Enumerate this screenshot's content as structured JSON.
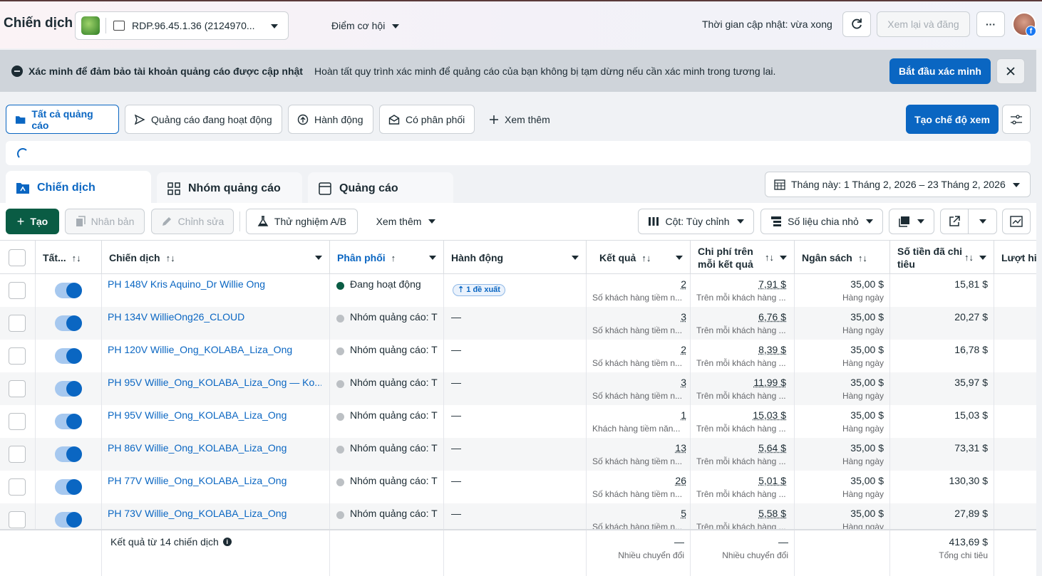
{
  "header": {
    "title": "Chiến dịch",
    "account_name": "RDP.96.45.1.36 (2124970...",
    "opportunity": "Điểm cơ hội",
    "update_time": "Thời gian cập nhật: vừa xong",
    "review_publish": "Xem lại và đăng",
    "more": "···"
  },
  "banner": {
    "bold": "Xác minh để đảm bảo tài khoản quảng cáo được cập nhật",
    "text": "Hoàn tất quy trình xác minh để quảng cáo của bạn không bị tạm dừng nếu cần xác minh trong tương lai.",
    "action": "Bắt đầu xác minh"
  },
  "filter_tabs": {
    "all": "Tất cả quảng cáo",
    "active": "Quảng cáo đang hoạt động",
    "actions": "Hành động",
    "delivered": "Có phân phối",
    "more": "Xem thêm",
    "create_view": "Tạo chế độ xem"
  },
  "level_tabs": {
    "campaign": "Chiến dịch",
    "adset": "Nhóm quảng cáo",
    "ad": "Quảng cáo"
  },
  "date_range": "Tháng này: 1 Tháng 2, 2026 – 23 Tháng 2, 2026",
  "toolbar": {
    "create": "Tạo",
    "duplicate": "Nhân bản",
    "edit": "Chỉnh sửa",
    "ab_test": "Thử nghiệm A/B",
    "more": "Xem thêm",
    "columns": "Cột: Tùy chỉnh",
    "breakdown": "Số liệu chia nhỏ"
  },
  "columns": {
    "toggle": "Tất...",
    "campaign": "Chiến dịch",
    "delivery": "Phân phối",
    "actions": "Hành động",
    "results": "Kết quả",
    "cpr_line1": "Chi phí trên",
    "cpr_line2": "mỗi kết quả",
    "budget": "Ngân sách",
    "spent_line1": "Số tiền đã chi",
    "spent_line2": "tiêu",
    "reach": "Lượt hi"
  },
  "rows": [
    {
      "name": "PH 148V Kris Aquino_Dr Willie Ong",
      "status": "active",
      "delivery": "Đang hoạt động",
      "action": "1 đề xuất",
      "result": "2",
      "result_sub": "Số khách hàng tiềm n...",
      "cpr": "7,91 $",
      "cpr_sub": "Trên mỗi khách hàng ...",
      "budget": "35,00 $",
      "budget_sub": "Hàng ngày",
      "spent": "15,81 $"
    },
    {
      "name": "PH 134V WillieOng26_CLOUD",
      "status": "off",
      "delivery": "Nhóm quảng cáo: T",
      "action": "—",
      "result": "3",
      "result_sub": "Số khách hàng tiềm n...",
      "cpr": "6,76 $",
      "cpr_sub": "Trên mỗi khách hàng ...",
      "budget": "35,00 $",
      "budget_sub": "Hàng ngày",
      "spent": "20,27 $"
    },
    {
      "name": "PH 120V Willie_Ong_KOLABA_Liza_Ong",
      "status": "off",
      "delivery": "Nhóm quảng cáo: T",
      "action": "—",
      "result": "2",
      "result_sub": "Số khách hàng tiềm n...",
      "cpr": "8,39 $",
      "cpr_sub": "Trên mỗi khách hàng ...",
      "budget": "35,00 $",
      "budget_sub": "Hàng ngày",
      "spent": "16,78 $"
    },
    {
      "name": "PH 95V Willie_Ong_KOLABA_Liza_Ong — Ko...",
      "status": "off",
      "delivery": "Nhóm quảng cáo: T",
      "action": "—",
      "result": "3",
      "result_sub": "Số khách hàng tiềm n...",
      "cpr": "11,99 $",
      "cpr_sub": "Trên mỗi khách hàng ...",
      "budget": "35,00 $",
      "budget_sub": "Hàng ngày",
      "spent": "35,97 $"
    },
    {
      "name": "PH 95V Willie_Ong_KOLABA_Liza_Ong",
      "status": "off",
      "delivery": "Nhóm quảng cáo: T",
      "action": "—",
      "result": "1",
      "result_sub": "Khách hàng tiềm năn...",
      "cpr": "15,03 $",
      "cpr_sub": "Trên mỗi khách hàng ...",
      "budget": "35,00 $",
      "budget_sub": "Hàng ngày",
      "spent": "15,03 $"
    },
    {
      "name": "PH 86V Willie_Ong_KOLABA_Liza_Ong",
      "status": "off",
      "delivery": "Nhóm quảng cáo: T",
      "action": "—",
      "result": "13",
      "result_sub": "Số khách hàng tiềm n...",
      "cpr": "5,64 $",
      "cpr_sub": "Trên mỗi khách hàng ...",
      "budget": "35,00 $",
      "budget_sub": "Hàng ngày",
      "spent": "73,31 $"
    },
    {
      "name": "PH 77V Willie_Ong_KOLABA_Liza_Ong",
      "status": "off",
      "delivery": "Nhóm quảng cáo: T",
      "action": "—",
      "result": "26",
      "result_sub": "Số khách hàng tiềm n...",
      "cpr": "5,01 $",
      "cpr_sub": "Trên mỗi khách hàng ...",
      "budget": "35,00 $",
      "budget_sub": "Hàng ngày",
      "spent": "130,30 $"
    },
    {
      "name": "PH 73V Willie_Ong_KOLABA_Liza_Ong",
      "status": "off",
      "delivery": "Nhóm quảng cáo: T",
      "action": "—",
      "result": "5",
      "result_sub": "Số khách hàng tiềm n...",
      "cpr": "5,58 $",
      "cpr_sub": "Trên mỗi khách hàng ...",
      "budget": "35,00 $",
      "budget_sub": "Hàng ngày",
      "spent": "27,89 $"
    }
  ],
  "footer": {
    "label": "Kết quả từ 14 chiến dịch",
    "results": "—",
    "results_sub": "Nhiều chuyển đổi",
    "cpr": "—",
    "cpr_sub": "Nhiều chuyển đổi",
    "spent": "413,69 $",
    "spent_sub": "Tổng chi tiêu"
  },
  "colors": {
    "accent": "#0a66c2",
    "create_green": "#0a5c44",
    "active_dot": "#0a5c44",
    "inactive_dot": "#bcc0c4"
  }
}
